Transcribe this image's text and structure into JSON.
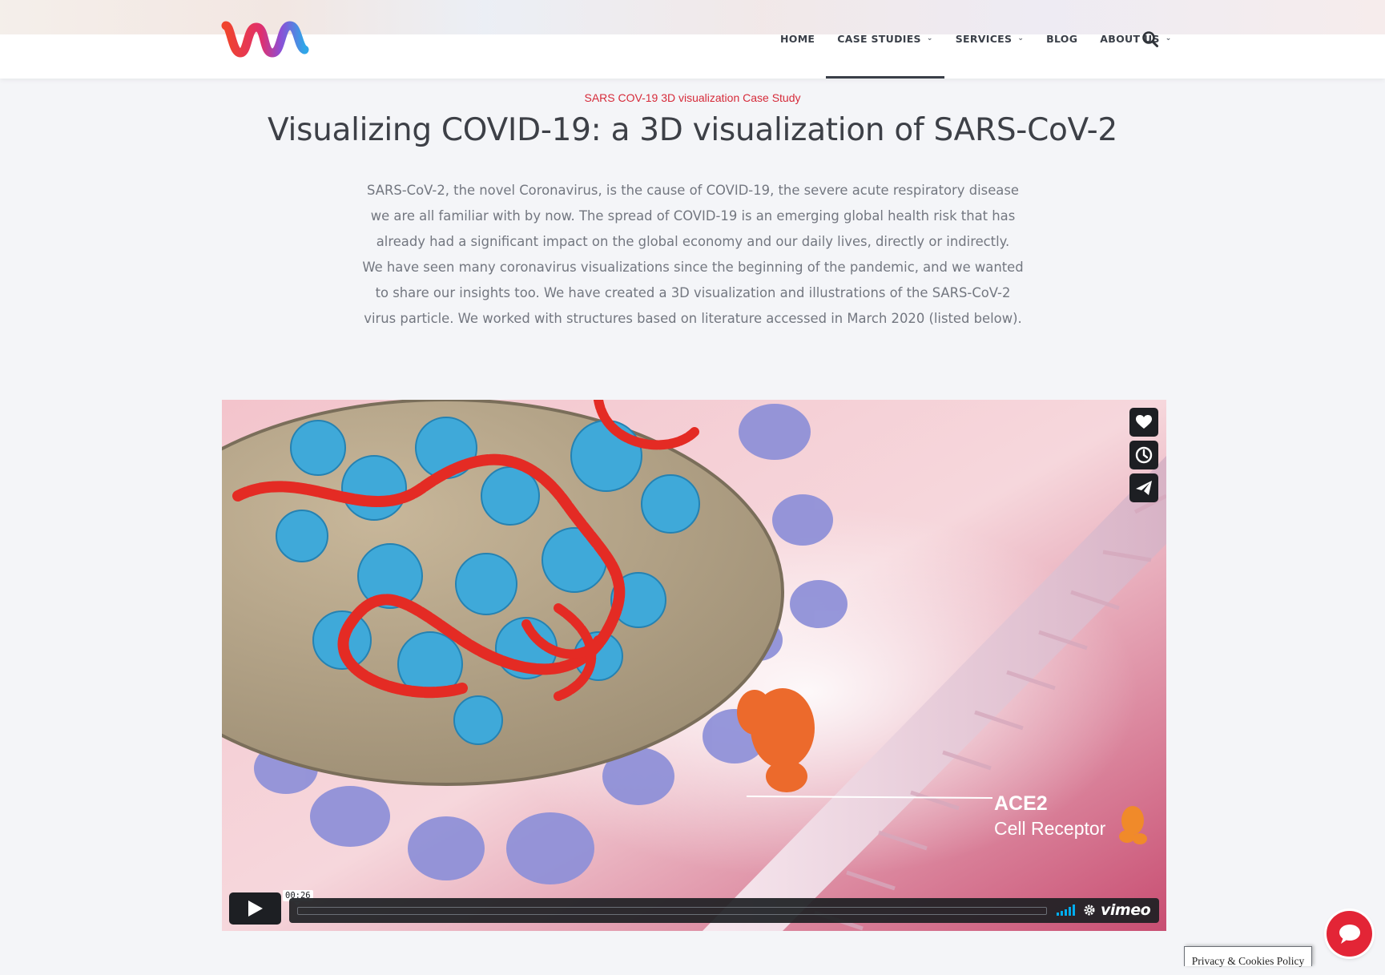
{
  "header": {
    "logo_name": "wm-logo",
    "nav": [
      {
        "label": "HOME",
        "has_dropdown": false
      },
      {
        "label": "CASE STUDIES",
        "has_dropdown": true,
        "active": true
      },
      {
        "label": "SERVICES",
        "has_dropdown": true
      },
      {
        "label": "BLOG",
        "has_dropdown": false
      },
      {
        "label": "ABOUT US",
        "has_dropdown": true
      }
    ],
    "search_icon": "search-icon"
  },
  "page": {
    "eyebrow": "SARS COV-19 3D visualization Case Study",
    "title": "Visualizing COVID-19: a 3D visualization of SARS-CoV-2",
    "intro_p1": "SARS-CoV-2, the novel Coronavirus, is the cause of COVID-19, the severe acute respiratory disease we are all familiar with by now. The spread of COVID-19 is an emerging global health risk that has already had a significant impact on the global economy and our daily lives, directly or indirectly.",
    "intro_p2": "We have seen many coronavirus visualizations since the beginning of the pandemic, and we wanted to share our insights too. We have created a 3D visualization and illustrations of the SARS-CoV-2 virus particle. We worked with structures based on literature accessed in March 2020 (listed below)."
  },
  "video": {
    "overlay_label": "ACE2",
    "overlay_sublabel": "Cell Receptor",
    "time": "00:26",
    "progress": 0.0,
    "brand": "vimeo",
    "side_buttons": [
      "like-icon",
      "watch-later-icon",
      "share-icon"
    ],
    "colors": {
      "accent": "#00adef",
      "control_bg": "#1d1f23"
    }
  },
  "footer": {
    "cookie_label": "Privacy & Cookies Policy",
    "chat_color": "#e32536"
  }
}
